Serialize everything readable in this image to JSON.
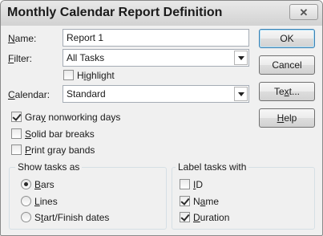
{
  "window": {
    "title": "Monthly Calendar Report Definition"
  },
  "fields": {
    "name": {
      "label": "Name:",
      "value": "Report 1"
    },
    "filter": {
      "label": "Filter:",
      "value": "All Tasks"
    },
    "highlight": {
      "label": "Highlight",
      "checked": false
    },
    "calendar": {
      "label": "Calendar:",
      "value": "Standard"
    }
  },
  "buttons": {
    "ok": "OK",
    "cancel": "Cancel",
    "text": "Text...",
    "help": "Help"
  },
  "options": [
    {
      "label": "Gray nonworking days",
      "checked": true
    },
    {
      "label": "Solid bar breaks",
      "checked": false
    },
    {
      "label": "Print gray bands",
      "checked": false
    }
  ],
  "show_tasks": {
    "title": "Show tasks as",
    "items": [
      {
        "label": "Bars",
        "selected": true
      },
      {
        "label": "Lines",
        "selected": false
      },
      {
        "label": "Start/Finish dates",
        "selected": false
      }
    ]
  },
  "label_tasks": {
    "title": "Label tasks with",
    "items": [
      {
        "label": "ID",
        "checked": false
      },
      {
        "label": "Name",
        "checked": true
      },
      {
        "label": "Duration",
        "checked": true
      }
    ]
  },
  "icons": {
    "close": "close-icon",
    "dropdown": "chevron-down-icon"
  }
}
